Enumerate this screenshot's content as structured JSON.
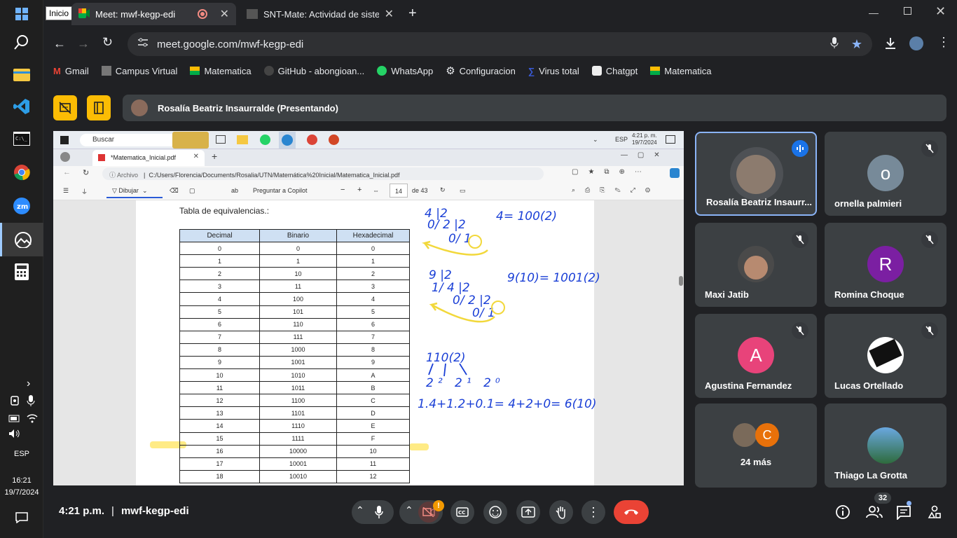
{
  "taskbar": {
    "lang": "ESP",
    "time": "16:21",
    "date": "19/7/2024",
    "start_tooltip": "Inicio"
  },
  "browser": {
    "tabs": [
      {
        "label": "Meet: mwf-kegp-edi"
      },
      {
        "label": "SNT-Mate: Actividad de sistema"
      }
    ],
    "url": "meet.google.com/mwf-kegp-edi",
    "bookmarks": [
      "Gmail",
      "Campus Virtual",
      "Matematica",
      "GitHub - abongioan...",
      "WhatsApp",
      "Configuracion",
      "Virus total",
      "Chatgpt",
      "Matematica"
    ]
  },
  "meet": {
    "presenter": "Rosalía Beatriz Insaurralde (Presentando)",
    "time": "4:21 p.m.",
    "separator": "|",
    "meeting_code": "mwf-kegp-edi",
    "participants_count": "32",
    "more_label": "24 más",
    "more_initial": "C",
    "tiles": [
      {
        "name": "Rosalía Beatriz Insaurr...",
        "initial": "",
        "color": "#5f6368"
      },
      {
        "name": "ornella palmieri",
        "initial": "o",
        "color": "#778a99"
      },
      {
        "name": "Maxi Jatib",
        "initial": "",
        "color": "#4a4a4a"
      },
      {
        "name": "Romina Choque",
        "initial": "R",
        "color": "#7b1fa2"
      },
      {
        "name": "Agustina Fernandez",
        "initial": "A",
        "color": "#e8437a"
      },
      {
        "name": "Lucas Ortellado",
        "initial": "",
        "color": "#ffffff"
      },
      {
        "name": "Thiago La Grotta",
        "initial": "",
        "color": "#3a6fa0"
      }
    ]
  },
  "shared": {
    "search": "Buscar",
    "tray_lang": "ESP",
    "tray_time": "4:21 p. m.",
    "tray_date": "19/7/2024",
    "edge_tab": "*Matematica_Inicial.pdf",
    "archive_label": "Archivo",
    "path": "C:/Users/Florencia/Documents/Rosalia/UTN/Matemática%20Inicial/Matematica_Inicial.pdf",
    "draw_label": "Dibujar",
    "copilot_label": "Preguntar a Copilot",
    "page_num": "14",
    "page_total": "de 43",
    "doc_title": "Tabla de equivalencias.:",
    "table_headers": [
      "Decimal",
      "Binario",
      "Hexadecimal"
    ],
    "table_rows": [
      [
        "0",
        "0",
        "0"
      ],
      [
        "1",
        "1",
        "1"
      ],
      [
        "2",
        "10",
        "2"
      ],
      [
        "3",
        "11",
        "3"
      ],
      [
        "4",
        "100",
        "4"
      ],
      [
        "5",
        "101",
        "5"
      ],
      [
        "6",
        "110",
        "6"
      ],
      [
        "7",
        "111",
        "7"
      ],
      [
        "8",
        "1000",
        "8"
      ],
      [
        "9",
        "1001",
        "9"
      ],
      [
        "10",
        "1010",
        "A"
      ],
      [
        "11",
        "1011",
        "B"
      ],
      [
        "12",
        "1100",
        "C"
      ],
      [
        "13",
        "1101",
        "D"
      ],
      [
        "14",
        "1110",
        "E"
      ],
      [
        "15",
        "1111",
        "F"
      ],
      [
        "16",
        "10000",
        "10"
      ],
      [
        "17",
        "10001",
        "11"
      ],
      [
        "18",
        "10010",
        "12"
      ]
    ],
    "handwriting": {
      "eq1": "4= 100(2)",
      "eq2": "9(10)= 1001(2)",
      "eq3": "1.4+1.2+0.1= 4+2+0= 6(10)",
      "bin": "110(2)",
      "powers": "2² 2¹ 2⁰",
      "div1": "4 |2",
      "div1b": "0/ 2 |2",
      "div1c": "0/ 1",
      "div2": "9 |2",
      "div2b": "1/ 4 |2",
      "div2c": "0/ 2 |2",
      "div2d": "0/ 1"
    }
  }
}
